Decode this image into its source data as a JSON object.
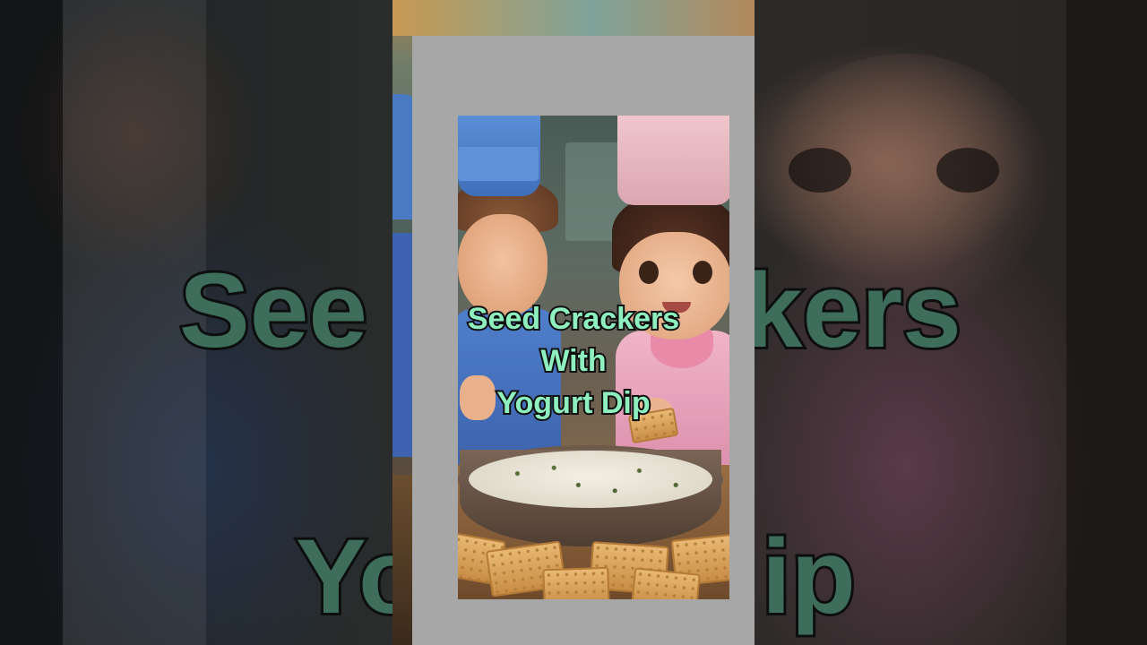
{
  "caption": {
    "line1": "Seed Crackers",
    "line2": "With",
    "line3": "Yogurt Dip"
  },
  "background_caption": {
    "top_left": "See",
    "top_right": "kers",
    "bottom_left": "Yo",
    "bottom_right": "ip"
  },
  "colors": {
    "caption_text": "#8ff0bf",
    "caption_outline": "#101010",
    "card_gray": "#a7a7a7"
  }
}
